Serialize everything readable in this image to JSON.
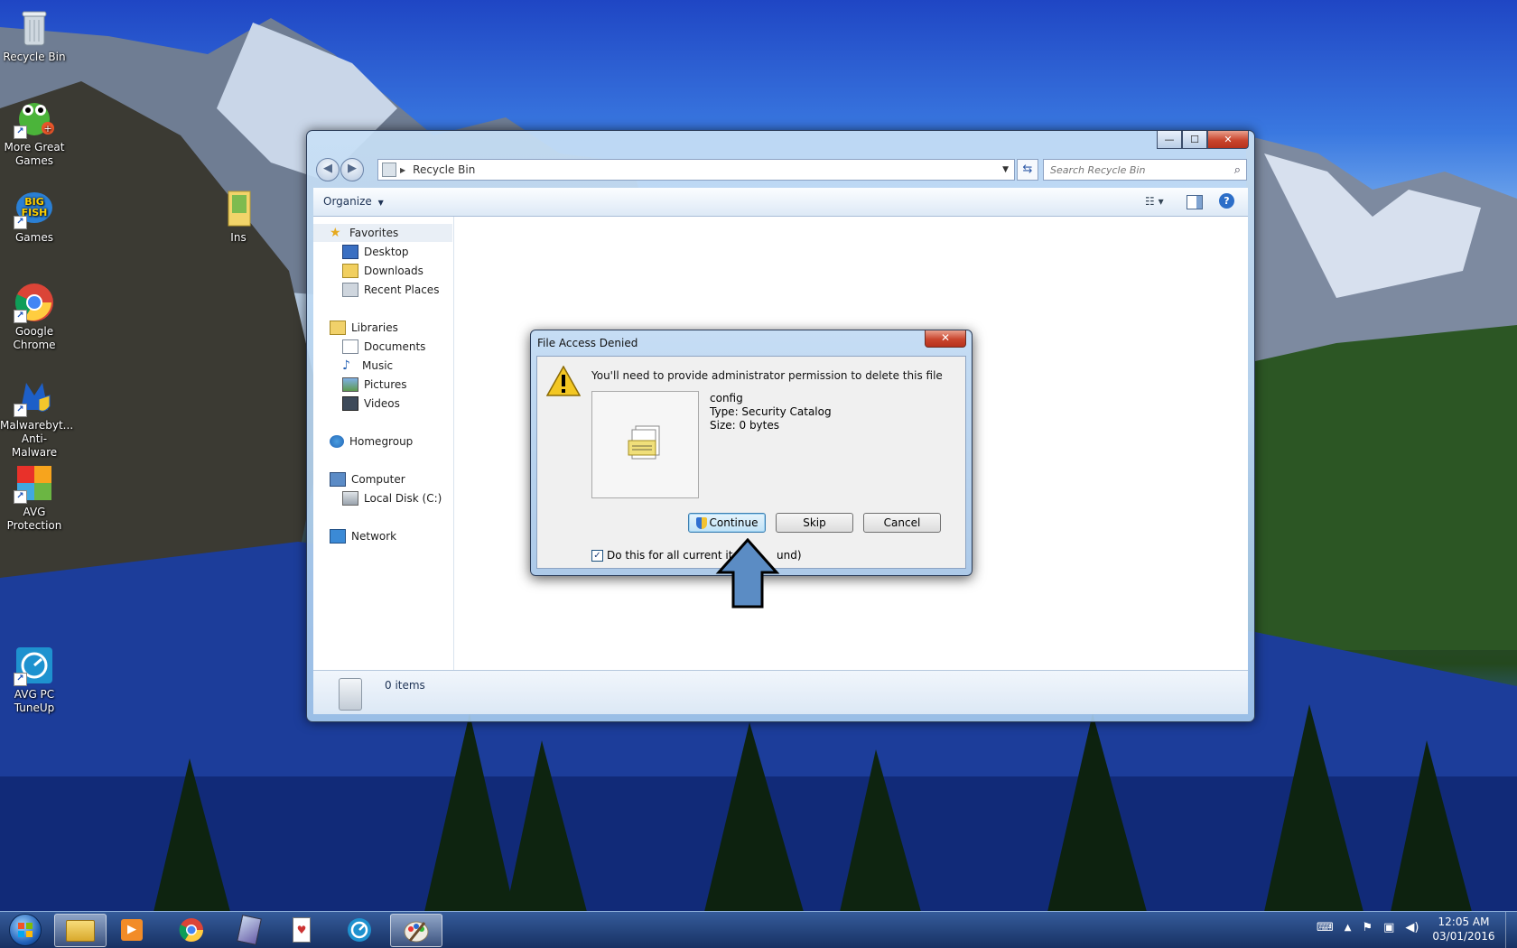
{
  "desktop": {
    "icons": [
      {
        "label": "Recycle Bin",
        "icon": "recycle-bin-icon"
      },
      {
        "label": "More Great Games",
        "icon": "games-frog-icon"
      },
      {
        "label": "Games",
        "icon": "big-fish-games-icon"
      },
      {
        "label": "Ins",
        "icon": "folder-icon"
      },
      {
        "label": "Google Chrome",
        "icon": "chrome-icon"
      },
      {
        "label": "Malwarebyt... Anti-Malware",
        "icon": "malwarebytes-icon"
      },
      {
        "label": "AVG Protection",
        "icon": "avg-icon"
      },
      {
        "label": "AVG PC TuneUp",
        "icon": "avg-tuneup-icon"
      }
    ]
  },
  "explorer": {
    "window_controls": {
      "minimize": "—",
      "maximize": "☐",
      "close": "✕"
    },
    "address": {
      "path": "Recycle Bin"
    },
    "search": {
      "placeholder": "Search Recycle Bin"
    },
    "toolbar": {
      "organize_label": "Organize"
    },
    "nav": {
      "favorites": "Favorites",
      "desktop": "Desktop",
      "downloads": "Downloads",
      "recent_places": "Recent Places",
      "libraries": "Libraries",
      "documents": "Documents",
      "music": "Music",
      "pictures": "Pictures",
      "videos": "Videos",
      "homegroup": "Homegroup",
      "computer": "Computer",
      "local_disk": "Local Disk (C:)",
      "network": "Network"
    },
    "status": {
      "item_count": "0 items"
    }
  },
  "dialog": {
    "title": "File Access Denied",
    "close": "✕",
    "message": "You'll need to provide administrator permission to delete this file",
    "file": {
      "name": "config",
      "type": "Type: Security Catalog",
      "size": "Size: 0 bytes"
    },
    "buttons": {
      "continue": "Continue",
      "skip": "Skip",
      "cancel": "Cancel"
    },
    "checkbox_visible": "Do this for all current ite",
    "checkbox_tail": "und)",
    "checkbox_checked": true
  },
  "taskbar": {
    "apps": [
      "start-orb-icon",
      "file-explorer-icon",
      "media-player-icon",
      "chrome-icon",
      "game-app-icon",
      "solitaire-icon",
      "avg-tuneup-icon",
      "paint-icon"
    ],
    "clock": {
      "time": "12:05 AM",
      "date": "03/01/2016"
    }
  },
  "colors": {
    "accent": "#3c7fb1",
    "close_red": "#c9452d",
    "arrow_fill": "#5b8cc4"
  }
}
